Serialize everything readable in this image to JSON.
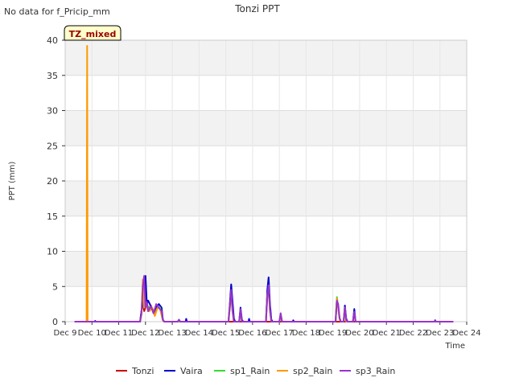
{
  "chart_data": {
    "type": "line",
    "title": "Tonzi PPT",
    "top_left_note": "No data for f_Pricip_mm",
    "badge": "TZ_mixed",
    "xlabel": "Time",
    "ylabel": "PPT (mm)",
    "ylim": [
      0,
      40
    ],
    "yticks": [
      0,
      5,
      10,
      15,
      20,
      25,
      30,
      35,
      40
    ],
    "xlim": [
      9,
      24
    ],
    "xticks": [
      {
        "v": 9,
        "label": "Dec 9"
      },
      {
        "v": 10,
        "label": "Dec 10"
      },
      {
        "v": 11,
        "label": "Dec 11"
      },
      {
        "v": 12,
        "label": "Dec 12"
      },
      {
        "v": 13,
        "label": "Dec 13"
      },
      {
        "v": 14,
        "label": "Dec 14"
      },
      {
        "v": 15,
        "label": "Dec 15"
      },
      {
        "v": 16,
        "label": "Dec 16"
      },
      {
        "v": 17,
        "label": "Dec 17"
      },
      {
        "v": 18,
        "label": "Dec 18"
      },
      {
        "v": 19,
        "label": "Dec 19"
      },
      {
        "v": 20,
        "label": "Dec 20"
      },
      {
        "v": 21,
        "label": "Dec 21"
      },
      {
        "v": 22,
        "label": "Dec 22"
      },
      {
        "v": 23,
        "label": "Dec 23"
      },
      {
        "v": 24,
        "label": "Dec 24"
      }
    ],
    "grid": true,
    "legend_position": "bottom",
    "series": [
      {
        "name": "Tonzi",
        "color": "#cc0000",
        "points": [
          [
            9.35,
            0
          ],
          [
            11.8,
            0
          ],
          [
            11.85,
            1.5
          ],
          [
            11.9,
            3
          ],
          [
            11.95,
            1.5
          ],
          [
            12.05,
            2.5
          ],
          [
            12.1,
            1.5
          ],
          [
            12.2,
            2.3
          ],
          [
            12.3,
            1.2
          ],
          [
            12.45,
            2.2
          ],
          [
            12.55,
            1.8
          ],
          [
            12.65,
            0.2
          ],
          [
            12.7,
            0
          ],
          [
            23.5,
            0
          ]
        ]
      },
      {
        "name": "Vaira",
        "color": "#0000cc",
        "points": [
          [
            9.35,
            0
          ],
          [
            10.1,
            0
          ],
          [
            10.12,
            0.1
          ],
          [
            10.14,
            0
          ],
          [
            11.8,
            0
          ],
          [
            11.85,
            1.5
          ],
          [
            11.9,
            2.8
          ],
          [
            11.95,
            2
          ],
          [
            12.0,
            6.5
          ],
          [
            12.05,
            2.5
          ],
          [
            12.1,
            3
          ],
          [
            12.2,
            2.2
          ],
          [
            12.3,
            1.5
          ],
          [
            12.4,
            2
          ],
          [
            12.5,
            2.5
          ],
          [
            12.6,
            2
          ],
          [
            12.65,
            0.3
          ],
          [
            12.7,
            0
          ],
          [
            13.5,
            0
          ],
          [
            13.52,
            0.4
          ],
          [
            13.55,
            0
          ],
          [
            15.1,
            0
          ],
          [
            15.15,
            2.5
          ],
          [
            15.2,
            5.3
          ],
          [
            15.25,
            3
          ],
          [
            15.3,
            0.5
          ],
          [
            15.35,
            0
          ],
          [
            15.5,
            0
          ],
          [
            15.55,
            2
          ],
          [
            15.6,
            0.3
          ],
          [
            15.65,
            0
          ],
          [
            15.85,
            0
          ],
          [
            15.87,
            0.4
          ],
          [
            15.9,
            0
          ],
          [
            16.5,
            0
          ],
          [
            16.55,
            4.5
          ],
          [
            16.6,
            6.3
          ],
          [
            16.65,
            2.5
          ],
          [
            16.7,
            0.3
          ],
          [
            16.75,
            0
          ],
          [
            17.0,
            0
          ],
          [
            17.05,
            1
          ],
          [
            17.1,
            0
          ],
          [
            17.5,
            0
          ],
          [
            17.52,
            0.2
          ],
          [
            17.55,
            0
          ],
          [
            19.1,
            0
          ],
          [
            19.15,
            3.2
          ],
          [
            19.2,
            2
          ],
          [
            19.25,
            0.5
          ],
          [
            19.3,
            0
          ],
          [
            19.4,
            0
          ],
          [
            19.45,
            2.3
          ],
          [
            19.5,
            0.4
          ],
          [
            19.55,
            0
          ],
          [
            19.75,
            0
          ],
          [
            19.8,
            1.8
          ],
          [
            19.85,
            0
          ],
          [
            22.8,
            0
          ],
          [
            22.82,
            0.2
          ],
          [
            22.85,
            0
          ],
          [
            23.5,
            0
          ]
        ]
      },
      {
        "name": "sp1_Rain",
        "color": "#33dd33",
        "points": [
          [
            9.35,
            0
          ],
          [
            11.8,
            0
          ],
          [
            11.85,
            1
          ],
          [
            11.9,
            5.5
          ],
          [
            11.95,
            2
          ],
          [
            12.05,
            2.5
          ],
          [
            12.15,
            1.8
          ],
          [
            12.25,
            2
          ],
          [
            12.35,
            1
          ],
          [
            12.45,
            2
          ],
          [
            12.55,
            2
          ],
          [
            12.65,
            0.2
          ],
          [
            12.7,
            0
          ],
          [
            15.1,
            0
          ],
          [
            15.15,
            2
          ],
          [
            15.2,
            4
          ],
          [
            15.25,
            1.5
          ],
          [
            15.3,
            0
          ],
          [
            15.5,
            0
          ],
          [
            15.55,
            1.5
          ],
          [
            15.6,
            0
          ],
          [
            16.5,
            0
          ],
          [
            16.55,
            3.5
          ],
          [
            16.6,
            4.8
          ],
          [
            16.65,
            1.5
          ],
          [
            16.7,
            0
          ],
          [
            17.0,
            0
          ],
          [
            17.05,
            0.8
          ],
          [
            17.1,
            0
          ],
          [
            19.1,
            0
          ],
          [
            19.15,
            3.5
          ],
          [
            19.2,
            2
          ],
          [
            19.25,
            0.4
          ],
          [
            19.3,
            0
          ],
          [
            19.4,
            0
          ],
          [
            19.45,
            1.8
          ],
          [
            19.5,
            0
          ],
          [
            19.75,
            0
          ],
          [
            19.8,
            1.3
          ],
          [
            19.85,
            0
          ],
          [
            23.5,
            0
          ]
        ]
      },
      {
        "name": "sp2_Rain",
        "color": "#ff9900",
        "points": [
          [
            9.35,
            0
          ],
          [
            9.8,
            0
          ],
          [
            9.82,
            39.2
          ],
          [
            9.84,
            0
          ],
          [
            11.8,
            0
          ],
          [
            11.85,
            1
          ],
          [
            11.9,
            6
          ],
          [
            11.95,
            2
          ],
          [
            12.05,
            2.2
          ],
          [
            12.15,
            1.5
          ],
          [
            12.25,
            2
          ],
          [
            12.35,
            0.8
          ],
          [
            12.45,
            2
          ],
          [
            12.55,
            1.8
          ],
          [
            12.65,
            0.2
          ],
          [
            12.7,
            0
          ],
          [
            13.2,
            0
          ],
          [
            13.25,
            0.2
          ],
          [
            13.3,
            0
          ],
          [
            15.1,
            0
          ],
          [
            15.15,
            2
          ],
          [
            15.2,
            4.2
          ],
          [
            15.25,
            1.5
          ],
          [
            15.3,
            0
          ],
          [
            15.5,
            0
          ],
          [
            15.55,
            1.5
          ],
          [
            15.6,
            0
          ],
          [
            16.5,
            0
          ],
          [
            16.55,
            3.8
          ],
          [
            16.6,
            4.8
          ],
          [
            16.65,
            1.5
          ],
          [
            16.7,
            0
          ],
          [
            17.0,
            0
          ],
          [
            17.05,
            1
          ],
          [
            17.1,
            0
          ],
          [
            19.1,
            0
          ],
          [
            19.15,
            3.3
          ],
          [
            19.2,
            2
          ],
          [
            19.25,
            0.4
          ],
          [
            19.3,
            0
          ],
          [
            19.4,
            0
          ],
          [
            19.45,
            2
          ],
          [
            19.5,
            0
          ],
          [
            19.75,
            0
          ],
          [
            19.8,
            1.2
          ],
          [
            19.85,
            0
          ],
          [
            23.5,
            0
          ]
        ]
      },
      {
        "name": "sp3_Rain",
        "color": "#9933cc",
        "points": [
          [
            9.35,
            0
          ],
          [
            11.8,
            0
          ],
          [
            11.85,
            1.2
          ],
          [
            11.9,
            5
          ],
          [
            11.95,
            6.5
          ],
          [
            12.0,
            2
          ],
          [
            12.05,
            2.8
          ],
          [
            12.1,
            1.5
          ],
          [
            12.2,
            2.2
          ],
          [
            12.3,
            1.2
          ],
          [
            12.4,
            2.5
          ],
          [
            12.5,
            2
          ],
          [
            12.6,
            1.5
          ],
          [
            12.65,
            0.3
          ],
          [
            12.7,
            0
          ],
          [
            13.2,
            0
          ],
          [
            13.25,
            0.3
          ],
          [
            13.3,
            0
          ],
          [
            15.1,
            0
          ],
          [
            15.15,
            2
          ],
          [
            15.2,
            4.5
          ],
          [
            15.25,
            1.8
          ],
          [
            15.3,
            0
          ],
          [
            15.5,
            0
          ],
          [
            15.55,
            1.8
          ],
          [
            15.6,
            0
          ],
          [
            16.5,
            0
          ],
          [
            16.55,
            3.5
          ],
          [
            16.6,
            5.2
          ],
          [
            16.65,
            1.8
          ],
          [
            16.7,
            0
          ],
          [
            17.0,
            0
          ],
          [
            17.05,
            1.2
          ],
          [
            17.1,
            0
          ],
          [
            19.1,
            0
          ],
          [
            19.15,
            3
          ],
          [
            19.2,
            2.5
          ],
          [
            19.25,
            0.5
          ],
          [
            19.3,
            0
          ],
          [
            19.4,
            0
          ],
          [
            19.45,
            2
          ],
          [
            19.5,
            0.2
          ],
          [
            19.55,
            0
          ],
          [
            19.75,
            0
          ],
          [
            19.8,
            1.4
          ],
          [
            19.85,
            0
          ],
          [
            22.8,
            0
          ],
          [
            22.82,
            0.1
          ],
          [
            22.85,
            0
          ],
          [
            23.5,
            0
          ]
        ]
      }
    ]
  }
}
